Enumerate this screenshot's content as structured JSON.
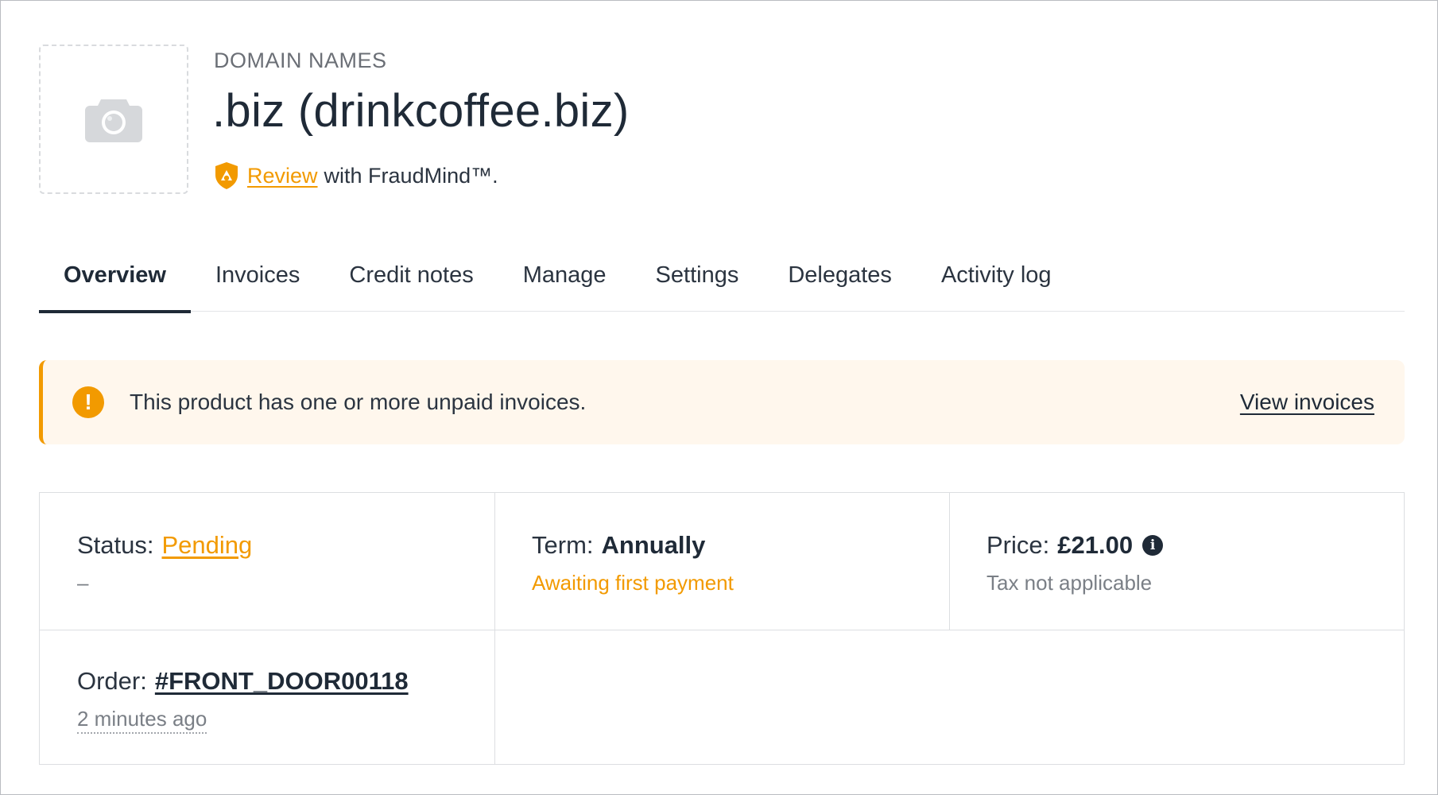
{
  "header": {
    "category": "DOMAIN NAMES",
    "title": ".biz (drinkcoffee.biz)",
    "review_link": "Review",
    "review_suffix": "with FraudMind™."
  },
  "tabs": [
    {
      "label": "Overview",
      "active": true
    },
    {
      "label": "Invoices",
      "active": false
    },
    {
      "label": "Credit notes",
      "active": false
    },
    {
      "label": "Manage",
      "active": false
    },
    {
      "label": "Settings",
      "active": false
    },
    {
      "label": "Delegates",
      "active": false
    },
    {
      "label": "Activity log",
      "active": false
    }
  ],
  "alert": {
    "icon": "!",
    "message": "This product has one or more unpaid invoices.",
    "link": "View invoices"
  },
  "details": {
    "status": {
      "label": "Status:",
      "value": "Pending",
      "sub": "–"
    },
    "term": {
      "label": "Term:",
      "value": "Annually",
      "sub": "Awaiting first payment"
    },
    "price": {
      "label": "Price:",
      "value": "£21.00",
      "sub": "Tax not applicable",
      "info_icon": "i"
    },
    "order": {
      "label": "Order:",
      "value": "#FRONT_DOOR00118",
      "sub": "2 minutes ago"
    }
  },
  "colors": {
    "accent": "#f29a00",
    "text": "#1f2a37",
    "alert_bg": "#fff7ed"
  },
  "icons": {
    "thumbnail": "camera-icon",
    "fraudmind": "shield-icon",
    "alert": "exclamation-circle-icon",
    "price": "info-icon"
  }
}
